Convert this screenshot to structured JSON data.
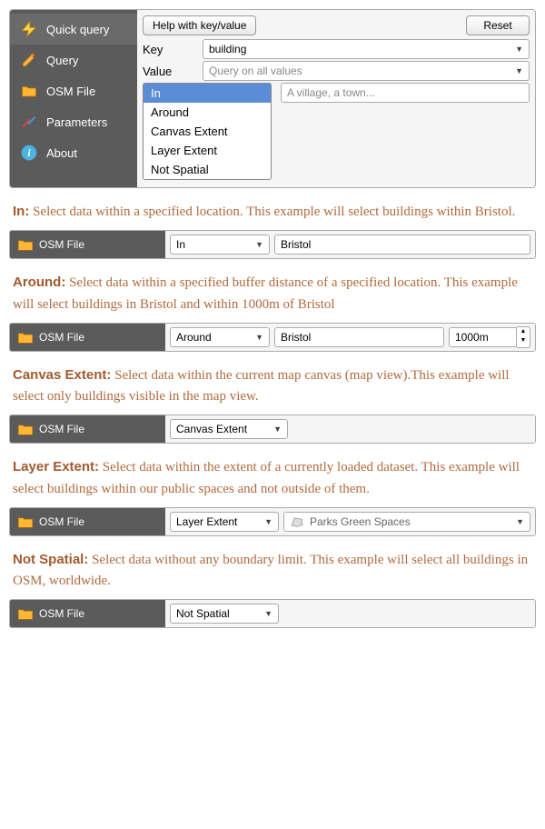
{
  "sidebar": {
    "items": [
      {
        "label": "Quick query"
      },
      {
        "label": "Query"
      },
      {
        "label": "OSM File"
      },
      {
        "label": "Parameters"
      },
      {
        "label": "About"
      }
    ]
  },
  "topbar": {
    "help_label": "Help with key/value",
    "reset_label": "Reset"
  },
  "form": {
    "key_label": "Key",
    "key_value": "building",
    "value_label": "Value",
    "value_placeholder": "Query on all values",
    "location_placeholder": "A village, a town..."
  },
  "spatial_options": [
    "In",
    "Around",
    "Canvas Extent",
    "Layer Extent",
    "Not Spatial"
  ],
  "osm_file_label": "OSM File",
  "examples": {
    "in": {
      "title": "In:",
      "text": " Select data within a specified location. This example will select buildings within Bristol.",
      "dropdown": "In",
      "value": "Bristol"
    },
    "around": {
      "title": "Around:",
      "text": " Select data within a specified buffer distance of a specified location. This example will select buildings in Bristol and within 1000m of Bristol",
      "dropdown": "Around",
      "value": "Bristol",
      "distance": "1000m"
    },
    "canvas": {
      "title": "Canvas Extent:",
      "text": " Select data within the current map canvas (map view).This example will select only buildings visible in the map view.",
      "dropdown": "Canvas Extent"
    },
    "layer": {
      "title": "Layer Extent:",
      "text": " Select data within the extent of a currently loaded dataset. This example will select buildings within our public spaces and not outside of them.",
      "dropdown": "Layer Extent",
      "layer": "Parks Green Spaces"
    },
    "notspatial": {
      "title": "Not Spatial:",
      "text": " Select data without any boundary limit. This example will select all buildings in OSM, worldwide.",
      "dropdown": "Not Spatial"
    }
  }
}
